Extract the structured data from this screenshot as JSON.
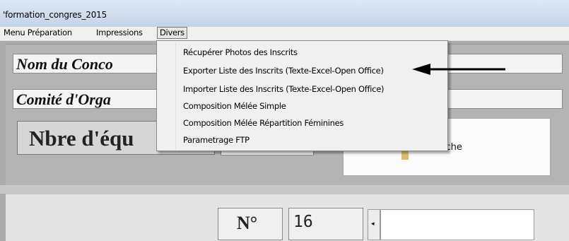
{
  "window": {
    "title": "'formation_congres_2015"
  },
  "menubar": {
    "items": [
      {
        "label": "Menu Préparation"
      },
      {
        "label": "Impressions"
      },
      {
        "label": "Divers"
      }
    ]
  },
  "divers_menu": {
    "items": [
      {
        "label": "Récupérer  Photos des Inscrits"
      },
      {
        "label": "Exporter Liste des Inscrits (Texte-Excel-Open Office)"
      },
      {
        "label": "Importer Liste des Inscrits (Texte-Excel-Open Office)"
      },
      {
        "label": "Composition  Mélée Simple"
      },
      {
        "label": "Composition Mélée Répartition Féminines"
      },
      {
        "label": "Parametrage FTP"
      }
    ]
  },
  "form": {
    "nom_label": "Nom du Conco",
    "comite_label": "Comité d'Orga",
    "nbre_label": "Nbre d'équ",
    "search_label": "echerche",
    "num_label": "N°",
    "num_value": "16"
  },
  "annotation": {
    "arrow_color": "#000000"
  }
}
